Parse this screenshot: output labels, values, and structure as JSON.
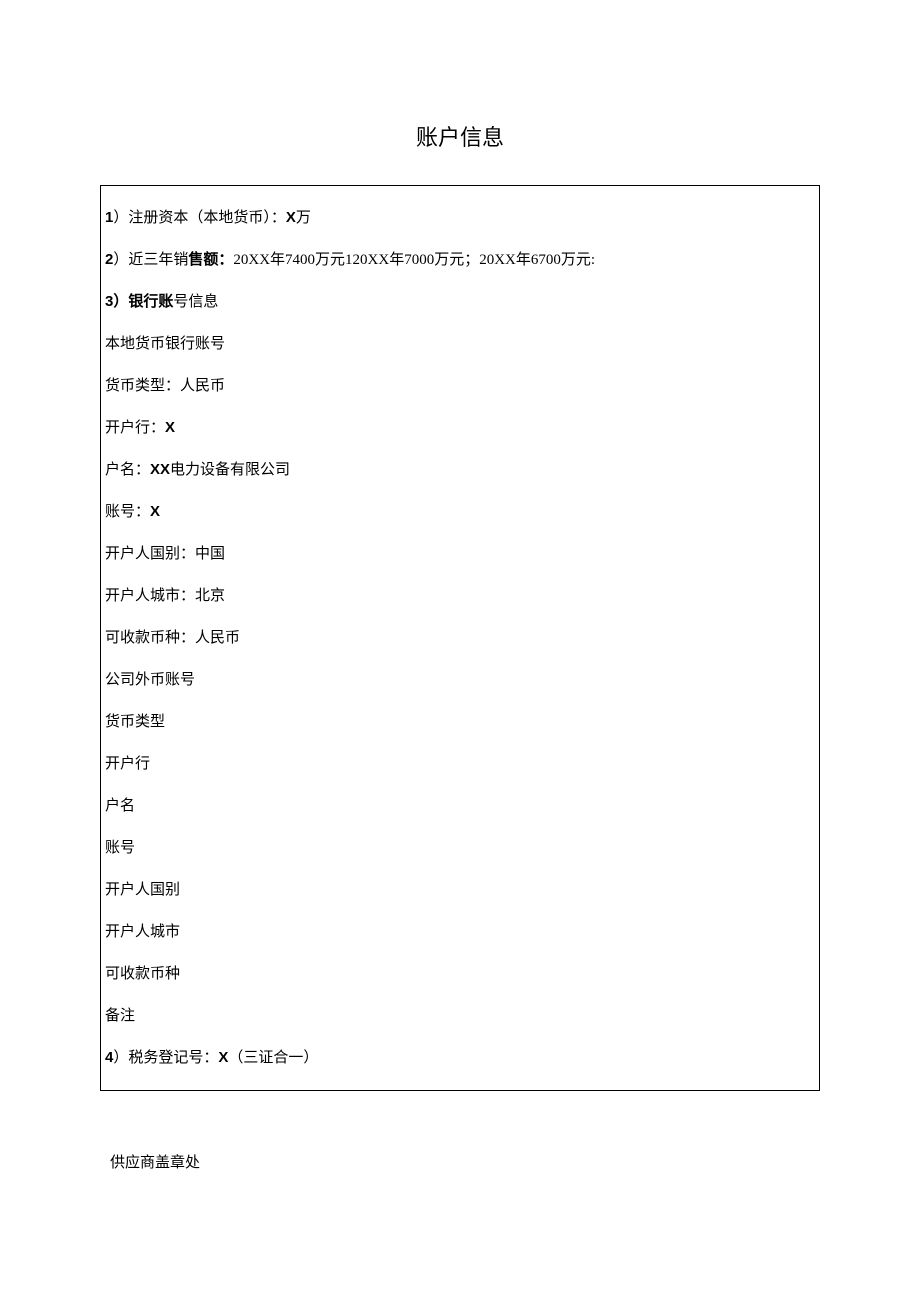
{
  "title": "账户信息",
  "rows": {
    "r1_num": "1",
    "r1_text": "）注册资本（本地货币）：",
    "r1_val": "X",
    "r1_suffix": "万",
    "r2_num": "2",
    "r2_text": "）近三年销",
    "r2_bold": "售额：",
    "r2_rest": "20XX年7400万元120XX年7000万元；20XX年6700万元:",
    "r3_num": "3",
    "r3_label": "）银行账",
    "r3_suffix": "号信息",
    "r4": "本地货币银行账号",
    "r5": "货币类型：人民币",
    "r6_pre": "开户行：",
    "r6_val": "X",
    "r7_pre": "户名：",
    "r7_val": "XX",
    "r7_suffix": "电力设备有限公司",
    "r8_pre": "账号：",
    "r8_val": "X",
    "r9": "开户人国别：中国",
    "r10": "开户人城市：北京",
    "r11": "可收款币种：人民币",
    "r12": "公司外币账号",
    "r13": "货币类型",
    "r14": "开户行",
    "r15": "户名",
    "r16": "账号",
    "r17": "开户人国别",
    "r18": "开户人城市",
    "r19": "可收款币种",
    "r20": "备注",
    "r21_num": "4",
    "r21_text": "）税务登记号：",
    "r21_val": "X",
    "r21_suffix": "（三证合一）"
  },
  "footer": "供应商盖章处"
}
